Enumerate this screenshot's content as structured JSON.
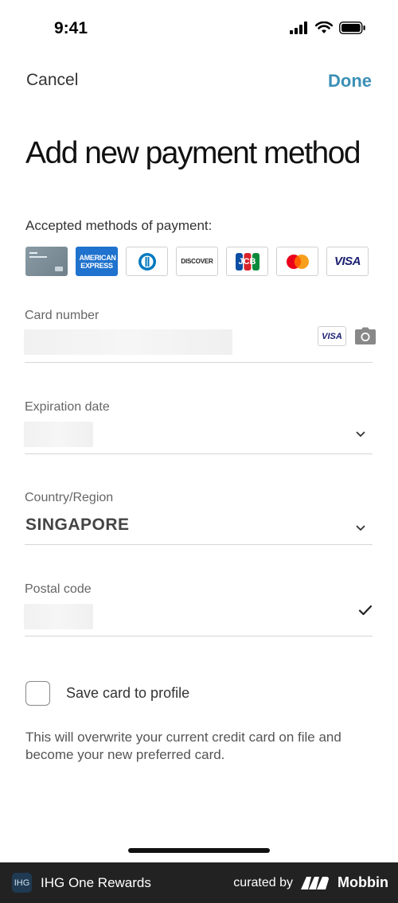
{
  "status_bar": {
    "time": "9:41"
  },
  "nav": {
    "cancel": "Cancel",
    "done": "Done"
  },
  "title": "Add new payment method",
  "accepted": {
    "label": "Accepted methods of payment:",
    "cards": [
      {
        "name": "ihg-card",
        "text": ""
      },
      {
        "name": "american-express",
        "text": "AMERICAN EXPRESS"
      },
      {
        "name": "diners-club",
        "text": ""
      },
      {
        "name": "discover",
        "text": "DISCOVER"
      },
      {
        "name": "jcb",
        "text": "JCB"
      },
      {
        "name": "mastercard",
        "text": ""
      },
      {
        "name": "visa",
        "text": "VISA"
      }
    ]
  },
  "fields": {
    "card_number": {
      "label": "Card number",
      "brand": "VISA"
    },
    "expiration": {
      "label": "Expiration date"
    },
    "country": {
      "label": "Country/Region",
      "value": "SINGAPORE"
    },
    "postal": {
      "label": "Postal code"
    }
  },
  "save_card": {
    "label": "Save card to profile"
  },
  "note": "This will overwrite your current credit card on file and become your new preferred card.",
  "footer": {
    "app_logo": "IHG",
    "app_name": "IHG One Rewards",
    "curated_by": "curated by",
    "brand": "Mobbin"
  },
  "colors": {
    "accent": "#3b8fb5",
    "amex": "#1f72cd",
    "visa": "#1a1f71",
    "jcb_blue": "#0b4ea2",
    "jcb_red": "#d8232a",
    "jcb_green": "#0a8a3a"
  }
}
